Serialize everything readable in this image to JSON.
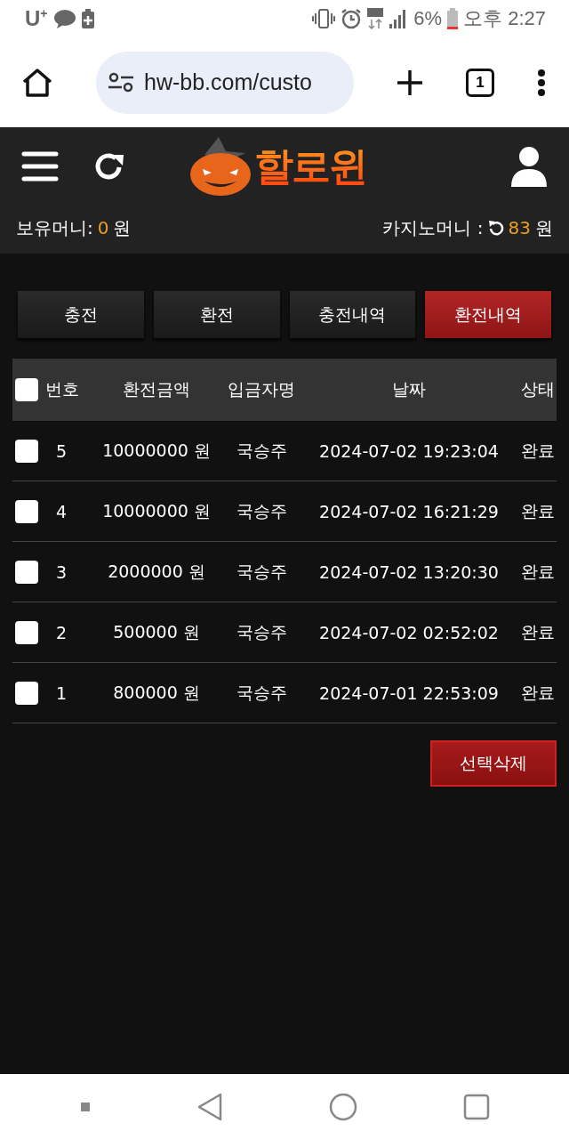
{
  "status_bar": {
    "carrier": "U$^{+}$",
    "battery": "6%",
    "time": "오후 2:27"
  },
  "browser": {
    "url": "hw-bb.com/custo",
    "tab_count": "1"
  },
  "header": {
    "logo": "할로윈"
  },
  "balance": {
    "own_label": "보유머니:",
    "own_value": "0",
    "own_unit": "원",
    "casino_label": "카지노머니 :",
    "casino_value": "83",
    "casino_unit": "원"
  },
  "tabs": [
    {
      "label": "충전",
      "selected": false
    },
    {
      "label": "환전",
      "selected": false
    },
    {
      "label": "충전내역",
      "selected": false
    },
    {
      "label": "환전내역",
      "selected": true
    }
  ],
  "table": {
    "select_all": false,
    "columns": [
      "번호",
      "환전금액",
      "입금자명",
      "날짜",
      "상태"
    ],
    "rows": [
      {
        "checked": false,
        "no": "5",
        "amount": "10000000 원",
        "name": "국승주",
        "date": "2024-07-02 19:23:04",
        "status": "완료"
      },
      {
        "checked": false,
        "no": "4",
        "amount": "10000000 원",
        "name": "국승주",
        "date": "2024-07-02 16:21:29",
        "status": "완료"
      },
      {
        "checked": false,
        "no": "3",
        "amount": "2000000 원",
        "name": "국승주",
        "date": "2024-07-02 13:20:30",
        "status": "완료"
      },
      {
        "checked": false,
        "no": "2",
        "amount": "500000 원",
        "name": "국승주",
        "date": "2024-07-02 02:52:02",
        "status": "완료"
      },
      {
        "checked": false,
        "no": "1",
        "amount": "800000 원",
        "name": "국승주",
        "date": "2024-07-01 22:53:09",
        "status": "완료"
      }
    ]
  },
  "delete_button": "선택삭제"
}
